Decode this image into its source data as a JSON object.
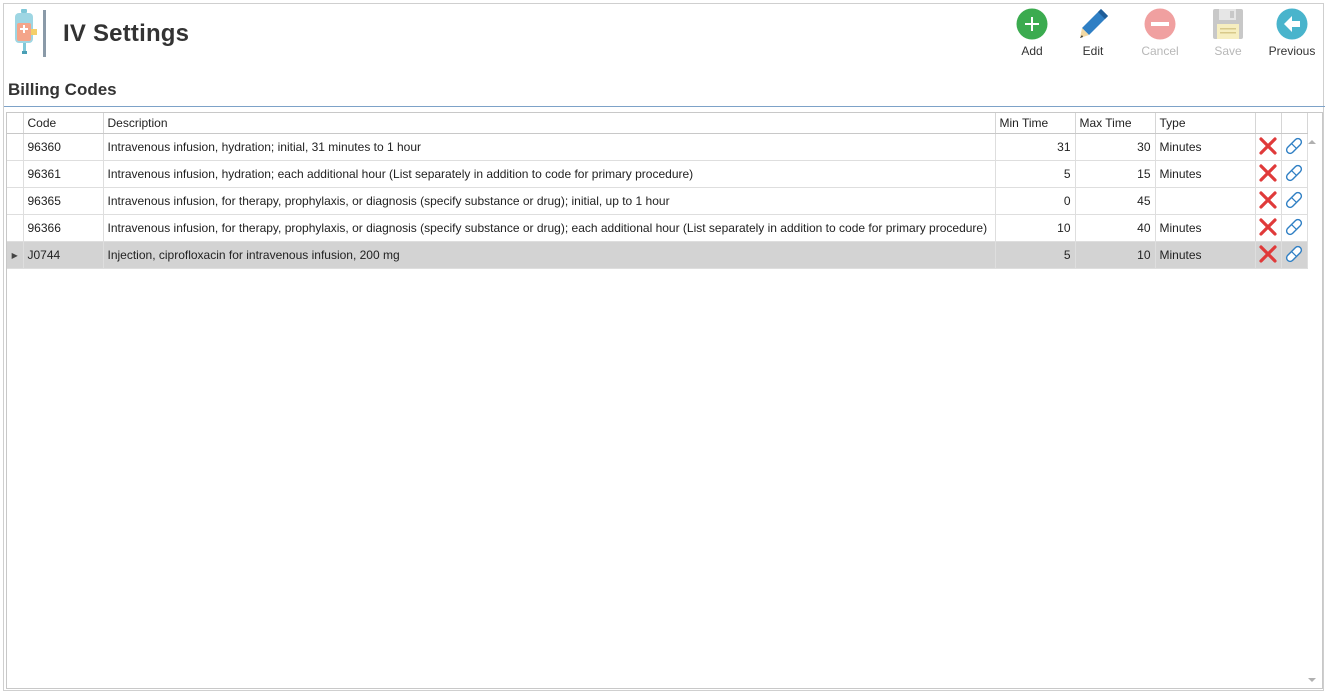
{
  "header": {
    "title": "IV Settings",
    "icon": "iv-bag-icon"
  },
  "toolbar": {
    "add_label": "Add",
    "edit_label": "Edit",
    "cancel_label": "Cancel",
    "save_label": "Save",
    "previous_label": "Previous"
  },
  "section": {
    "title": "Billing Codes"
  },
  "table": {
    "columns": {
      "code": "Code",
      "description": "Description",
      "min_time": "Min Time",
      "max_time": "Max Time",
      "type": "Type"
    },
    "rows": [
      {
        "code": "96360",
        "description": "Intravenous infusion, hydration; initial, 31 minutes to 1 hour",
        "min_time": "31",
        "max_time": "30",
        "type": "Minutes"
      },
      {
        "code": "96361",
        "description": "Intravenous infusion, hydration; each additional hour (List separately in addition to code for primary procedure)",
        "min_time": "5",
        "max_time": "15",
        "type": "Minutes"
      },
      {
        "code": "96365",
        "description": "Intravenous infusion, for therapy, prophylaxis, or diagnosis (specify substance or drug); initial, up to 1 hour",
        "min_time": "0",
        "max_time": "45",
        "type": ""
      },
      {
        "code": "96366",
        "description": "Intravenous infusion, for therapy, prophylaxis, or diagnosis (specify substance or drug); each additional hour (List separately in addition to code for primary procedure)",
        "min_time": "10",
        "max_time": "40",
        "type": "Minutes"
      },
      {
        "code": "J0744",
        "description": "Injection, ciprofloxacin for intravenous infusion, 200 mg",
        "min_time": "5",
        "max_time": "10",
        "type": "Minutes"
      }
    ],
    "selected_row": "J0744"
  },
  "colors": {
    "add_green": "#3bab4f",
    "edit_blue": "#2f7fc4",
    "disabled_red": "#f0a0a0",
    "previous_teal": "#49b4cc",
    "delete_red": "#e03a3a",
    "section_rule": "#7da2c8",
    "selected_row": "#d3d3d3"
  }
}
